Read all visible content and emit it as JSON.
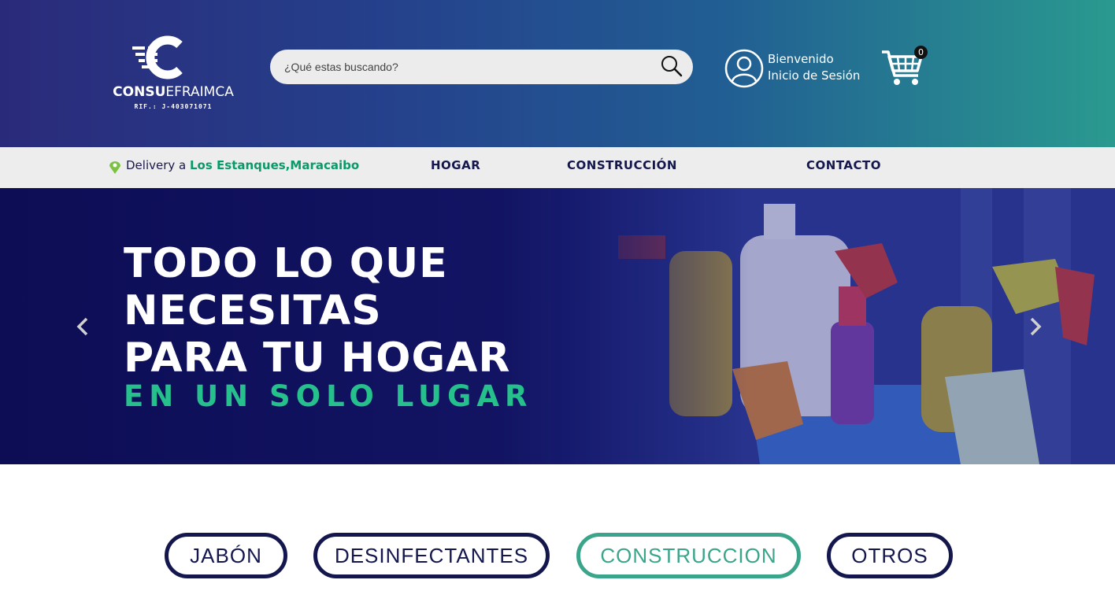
{
  "brand": {
    "name_bold": "CONSU",
    "name_light": "EFRAIMCA",
    "rif": "RIF.: J-403071071"
  },
  "search": {
    "placeholder": "¿Qué estas buscando?"
  },
  "account": {
    "greeting": "Bienvenido",
    "login": "Inicio de Sesión"
  },
  "cart": {
    "count": "0"
  },
  "nav": {
    "delivery_prefix": "Delivery a ",
    "location_area": "Los Estanques,",
    "location_city": "Maracaibo",
    "links": [
      "HOGAR",
      "CONSTRUCCIÓN",
      "CONTACTO"
    ]
  },
  "hero": {
    "line1": "TODO LO QUE",
    "line2": "NECESITAS",
    "line3": "PARA TU HOGAR",
    "subtitle": "EN UN SOLO LUGAR"
  },
  "categories": [
    "JABÓN",
    "DESINFECTANTES",
    "CONSTRUCCION",
    "OTROS"
  ],
  "active_category": "CONSTRUCCION",
  "colors": {
    "navy": "#14174e",
    "green": "#25c08c",
    "nav_bg": "#ededed"
  }
}
